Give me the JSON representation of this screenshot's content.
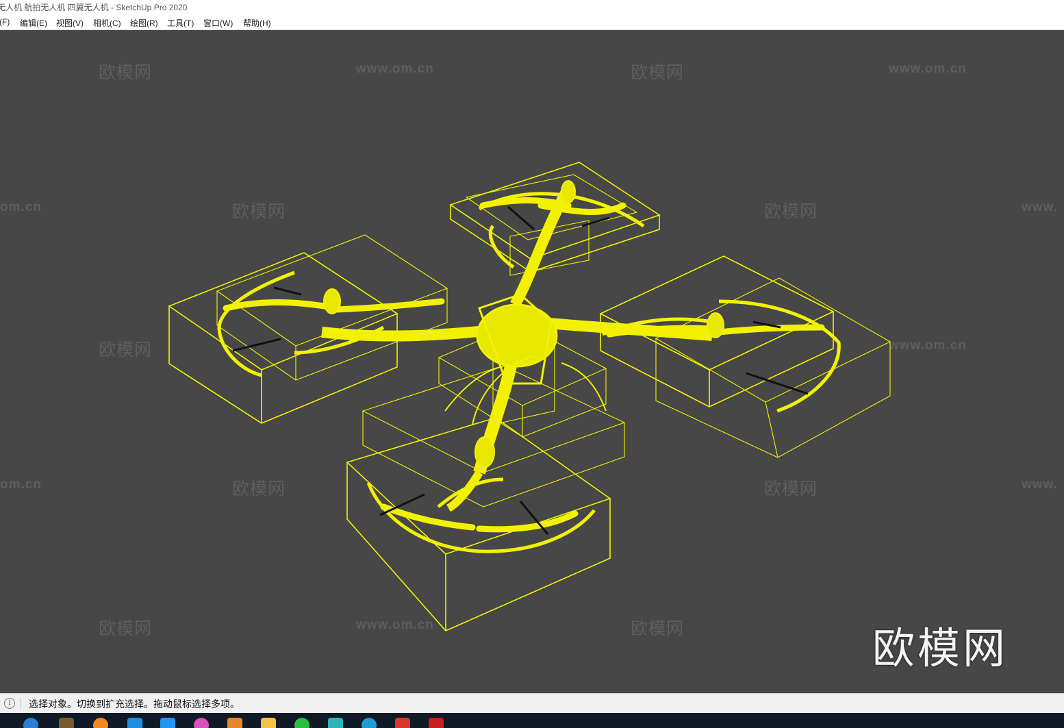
{
  "window": {
    "title": "无人机 航拍无人机 四翼无人机 - SketchUp Pro 2020"
  },
  "menu": {
    "items": [
      {
        "label": "(F)",
        "icon": "file-menu"
      },
      {
        "label": "编辑(E)"
      },
      {
        "label": "视图(V)"
      },
      {
        "label": "相机(C)"
      },
      {
        "label": "绘图(R)"
      },
      {
        "label": "工具(T)"
      },
      {
        "label": "窗口(W)"
      },
      {
        "label": "帮助(H)"
      }
    ]
  },
  "viewport": {
    "background": "#474747",
    "model_color": "#f2f200",
    "edge_color": "#111111",
    "watermark_brand": "欧模网",
    "watermark_url": "www.om.cn",
    "watermark_url_cut_right": "www.",
    "watermark_url_cut_left": "om.cn",
    "logo_text": "欧模网"
  },
  "status": {
    "icon": "info-icon",
    "text": "选择对象。切换到扩充选择。拖动鼠标选择多项。"
  },
  "taskbar": {
    "background": "#101a26",
    "apps": [
      {
        "name": "ie-browser-icon",
        "color": "#2a7fd4"
      },
      {
        "name": "minecraft-icon",
        "color": "#7a5a2e"
      },
      {
        "name": "media-player-icon",
        "color": "#f08a1c"
      },
      {
        "name": "store-icon",
        "color": "#1f8de0"
      },
      {
        "name": "video-app-icon",
        "color": "#2196f3"
      },
      {
        "name": "color-app-icon",
        "color": "#d94fbf"
      },
      {
        "name": "pdf-app-icon",
        "color": "#e6882a"
      },
      {
        "name": "folder-icon",
        "color": "#f2c443"
      },
      {
        "name": "wechat-icon",
        "color": "#27c03c"
      },
      {
        "name": "3dsmax-icon",
        "color": "#2fb4b8"
      },
      {
        "name": "edge-icon",
        "color": "#1e9bd9"
      },
      {
        "name": "sketchup-icon",
        "color": "#d8362c"
      },
      {
        "name": "autocad-icon",
        "color": "#c81e1e"
      }
    ]
  }
}
